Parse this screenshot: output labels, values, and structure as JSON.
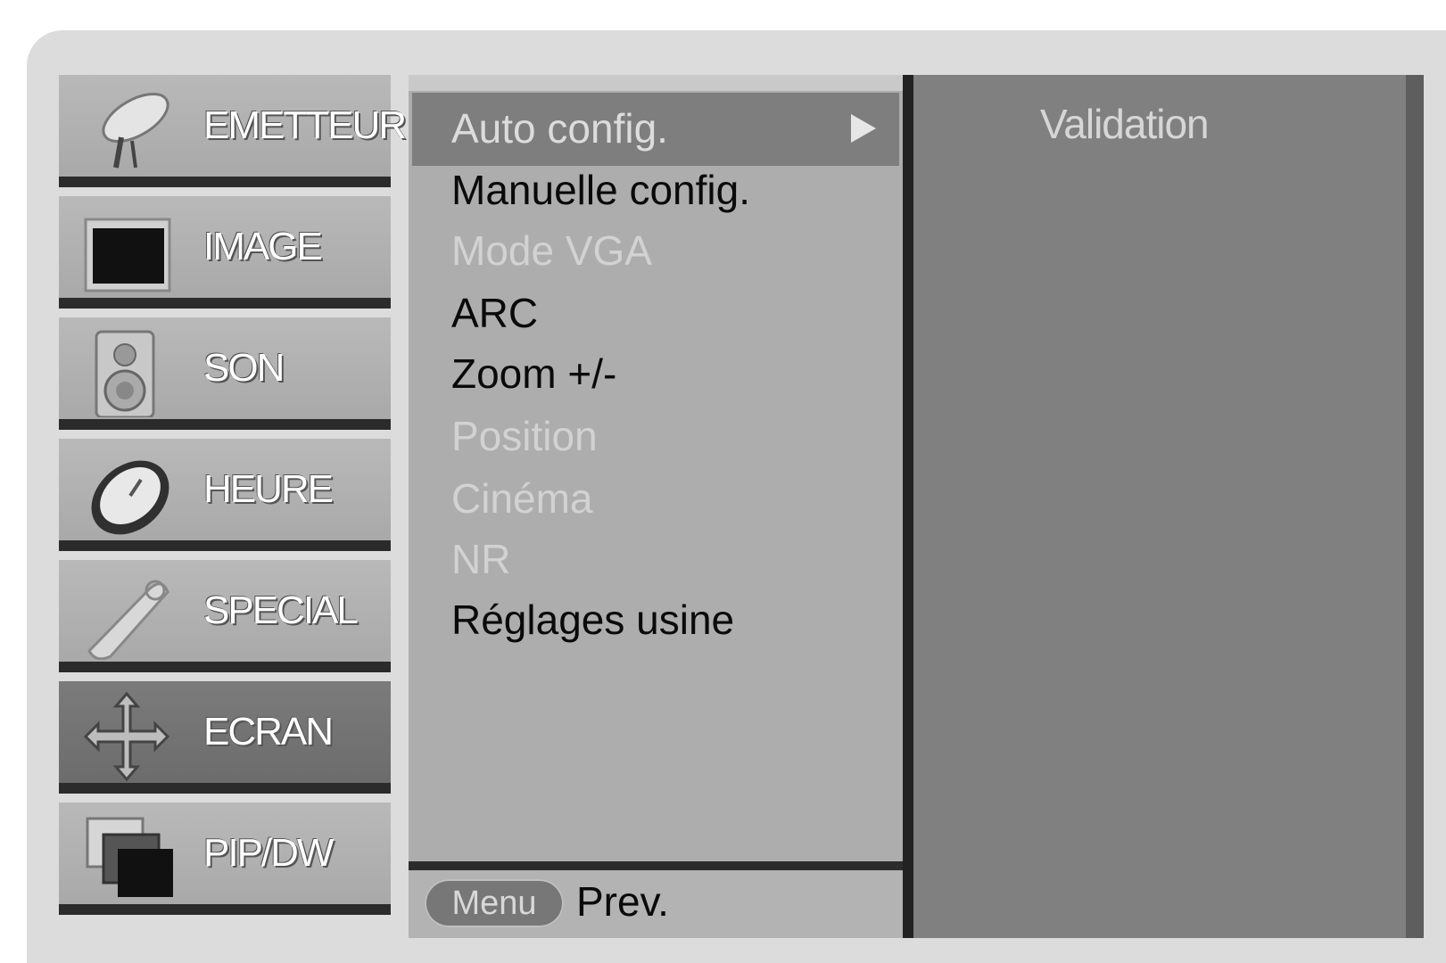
{
  "categories": [
    {
      "label": "EMETTEUR",
      "icon": "satellite-dish-icon"
    },
    {
      "label": "IMAGE",
      "icon": "monitor-icon"
    },
    {
      "label": "SON",
      "icon": "speaker-icon"
    },
    {
      "label": "HEURE",
      "icon": "clock-icon"
    },
    {
      "label": "SPECIAL",
      "icon": "remote-control-icon"
    },
    {
      "label": "ECRAN",
      "icon": "move-arrows-icon",
      "active": true
    },
    {
      "label": "PIP/DW",
      "icon": "pip-windows-icon"
    }
  ],
  "submenu": {
    "items": [
      {
        "label": "Auto config.",
        "state": "selected"
      },
      {
        "label": "Manuelle config.",
        "state": "enabled"
      },
      {
        "label": "Mode VGA",
        "state": "disabled"
      },
      {
        "label": "ARC",
        "state": "enabled"
      },
      {
        "label": "Zoom +/-",
        "state": "enabled"
      },
      {
        "label": "Position",
        "state": "disabled"
      },
      {
        "label": "Cinéma",
        "state": "disabled"
      },
      {
        "label": "NR",
        "state": "disabled"
      },
      {
        "label": "Réglages usine",
        "state": "enabled"
      }
    ],
    "footer": {
      "menu_button": "Menu",
      "prev_label": "Prev."
    }
  },
  "right_panel": {
    "label": "Validation"
  },
  "colors": {
    "active_category": "#6c6c6c",
    "selected_item": "#7e7e7e",
    "disabled_text": "#d2d2d2",
    "right_panel": "#808080"
  }
}
